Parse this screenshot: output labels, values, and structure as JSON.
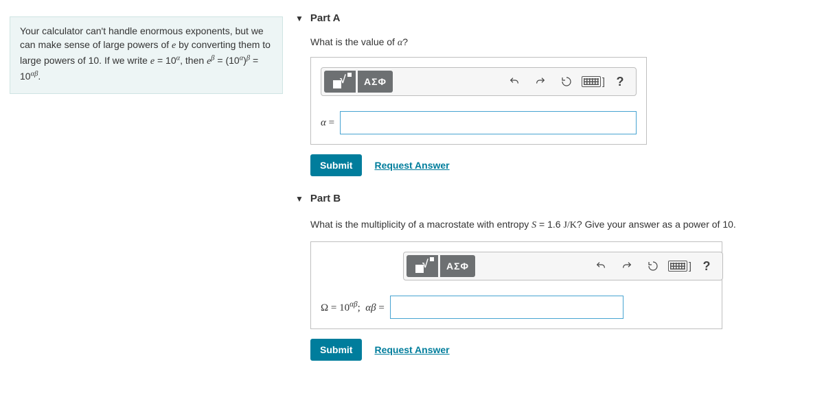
{
  "sidebar": {
    "info_html": "Your calculator can't handle enormous exponents, but we can make sense of large powers of e by converting them to large powers of 10. If we write e = 10^α, then e^β = (10^α)^β = 10^(αβ)."
  },
  "partA": {
    "title": "Part A",
    "question_prefix": "What is the value of ",
    "question_var": "α",
    "question_suffix": "?",
    "toolbar": {
      "greek": "ΑΣΦ",
      "help": "?"
    },
    "label_prefix": "α",
    "label_eq": " = ",
    "submit": "Submit",
    "request": "Request Answer"
  },
  "partB": {
    "title": "Part B",
    "q_p1": "What is the multiplicity of a macrostate with entropy ",
    "q_var": "S",
    "q_p2": " = 1.6 ",
    "q_unit": "J/K",
    "q_p3": "? Give your answer as a power of 10.",
    "toolbar": {
      "greek": "ΑΣΦ",
      "help": "?"
    },
    "label_html": "Ω = 10^(αβ);  αβ = ",
    "submit": "Submit",
    "request": "Request Answer"
  }
}
